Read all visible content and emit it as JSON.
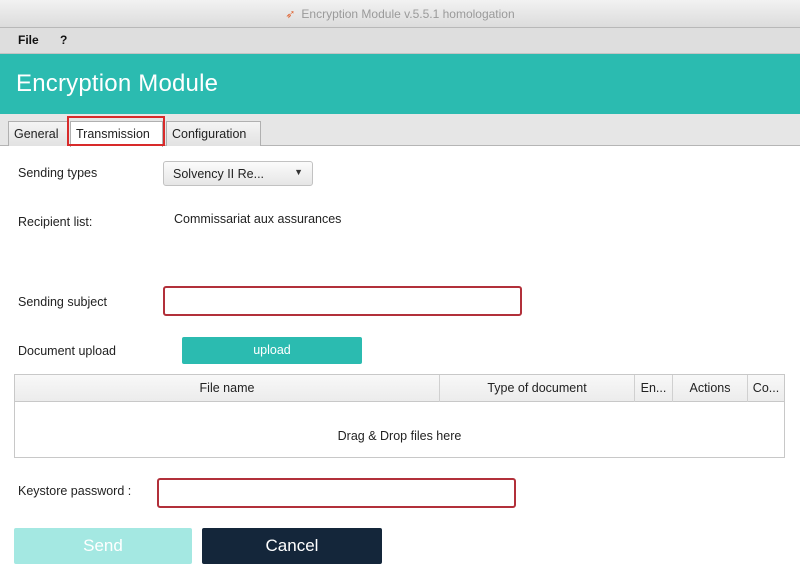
{
  "window": {
    "title": "Encryption Module v.5.5.1 homologation",
    "app_icon": "feather-icon"
  },
  "menu": {
    "file": "File",
    "help": "?"
  },
  "header": {
    "title": "Encryption Module",
    "accent": "#2bbbb0"
  },
  "tabs": {
    "general": "General",
    "transmission": "Transmission",
    "configuration": "Configuration",
    "active": "Transmission"
  },
  "form": {
    "sending_types_label": "Sending types",
    "sending_types_value": "Solvency II Re...",
    "recipient_label": "Recipient list:",
    "recipient_value": "Commissariat aux assurances",
    "subject_label": "Sending subject",
    "subject_value": "",
    "document_upload_label": "Document upload",
    "upload_button": "upload",
    "keystore_label": "Keystore password :",
    "keystore_value": ""
  },
  "table": {
    "columns": [
      "File name",
      "Type of document",
      "En...",
      "Actions",
      "Co..."
    ],
    "empty_text": "Drag & Drop files here"
  },
  "buttons": {
    "send": "Send",
    "cancel": "Cancel"
  },
  "colors": {
    "teal": "#2bbbb0",
    "send_disabled": "#a4e8e2",
    "cancel": "#14263a",
    "error_border": "#b2303a",
    "highlight": "#d82a2a"
  }
}
